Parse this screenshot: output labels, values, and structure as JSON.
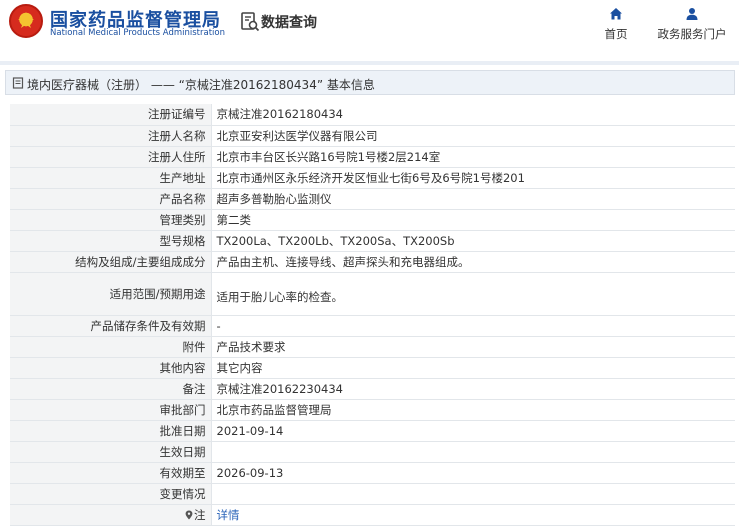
{
  "header": {
    "site_name_cn": "国家药品监督管理局",
    "site_name_en": "National Medical Products Administration",
    "section_title": "数据查询",
    "nav": [
      {
        "label": "首页",
        "icon": "home-icon"
      },
      {
        "label": "政务服务门户",
        "icon": "user-icon"
      }
    ]
  },
  "breadcrumb": {
    "text": "境内医疗器械（注册） —— “京械注准20162180434” 基本信息"
  },
  "details": [
    {
      "key": "注册证编号",
      "value": "京械注准20162180434"
    },
    {
      "key": "注册人名称",
      "value": "北京亚安利达医学仪器有限公司"
    },
    {
      "key": "注册人住所",
      "value": "北京市丰台区长兴路16号院1号楼2层214室"
    },
    {
      "key": "生产地址",
      "value": "北京市通州区永乐经济开发区恒业七街6号及6号院1号楼201"
    },
    {
      "key": "产品名称",
      "value": "超声多普勒胎心监测仪"
    },
    {
      "key": "管理类别",
      "value": "第二类"
    },
    {
      "key": "型号规格",
      "value": "TX200La、TX200Lb、TX200Sa、TX200Sb"
    },
    {
      "key": "结构及组成/主要组成成分",
      "value": "产品由主机、连接导线、超声探头和充电器组成。"
    },
    {
      "key": "适用范围/预期用途",
      "value": "适用于胎儿心率的检查。"
    },
    {
      "key": "产品储存条件及有效期",
      "value": "-"
    },
    {
      "key": "附件",
      "value": "产品技术要求"
    },
    {
      "key": "其他内容",
      "value": "其它内容"
    },
    {
      "key": "备注",
      "value": "京械注准20162230434"
    },
    {
      "key": "审批部门",
      "value": "北京市药品监督管理局"
    },
    {
      "key": "批准日期",
      "value": "2021-09-14"
    },
    {
      "key": "生效日期",
      "value": ""
    },
    {
      "key": "有效期至",
      "value": "2026-09-13"
    },
    {
      "key": "变更情况",
      "value": ""
    },
    {
      "key": "注",
      "value": "详情"
    }
  ]
}
